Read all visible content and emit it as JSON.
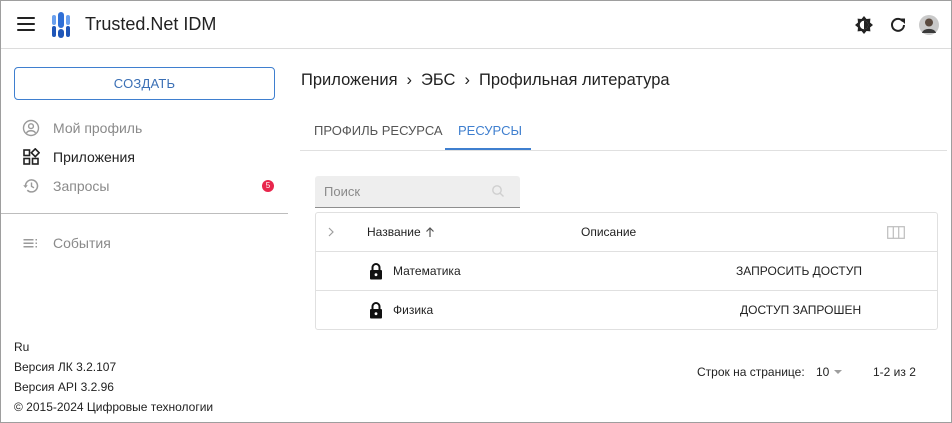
{
  "header": {
    "title": "Trusted.Net IDM",
    "icons": [
      "menu-icon",
      "brightness-icon",
      "refresh-icon",
      "avatar"
    ]
  },
  "sidebar": {
    "create_label": "СОЗДАТЬ",
    "items": [
      {
        "label": "Мой профиль",
        "icon": "account-circle-icon",
        "active": false
      },
      {
        "label": "Приложения",
        "icon": "apps-icon",
        "active": true
      },
      {
        "label": "Запросы",
        "icon": "history-icon",
        "active": false,
        "badge": "5"
      },
      {
        "label": "События",
        "icon": "events-list-icon",
        "active": false
      }
    ],
    "footer": {
      "lang": "Ru",
      "lk_version": "Версия ЛК 3.2.107",
      "api_version": "Версия API 3.2.96",
      "copyright": "© 2015-2024 Цифровые технологии"
    }
  },
  "breadcrumb": {
    "items": [
      "Приложения",
      "ЭБС",
      "Профильная литература"
    ],
    "separator": "›"
  },
  "tabs": [
    {
      "label": "ПРОФИЛЬ РЕСУРСА",
      "active": false
    },
    {
      "label": "РЕСУРСЫ",
      "active": true
    }
  ],
  "search": {
    "placeholder": "Поиск",
    "value": ""
  },
  "table": {
    "columns": {
      "name": "Название",
      "description": "Описание"
    },
    "rows": [
      {
        "name": "Математика",
        "description": "",
        "action": "ЗАПРОСИТЬ ДОСТУП"
      },
      {
        "name": "Физика",
        "description": "",
        "action": "ДОСТУП ЗАПРОШЕН"
      }
    ]
  },
  "pagination": {
    "rows_per_page_label": "Строк на странице:",
    "rows_per_page": "10",
    "range": "1-2 из 2"
  },
  "colors": {
    "accent": "#3f7fcf",
    "badge": "#e8264c",
    "logo": "#2f6fd6"
  }
}
